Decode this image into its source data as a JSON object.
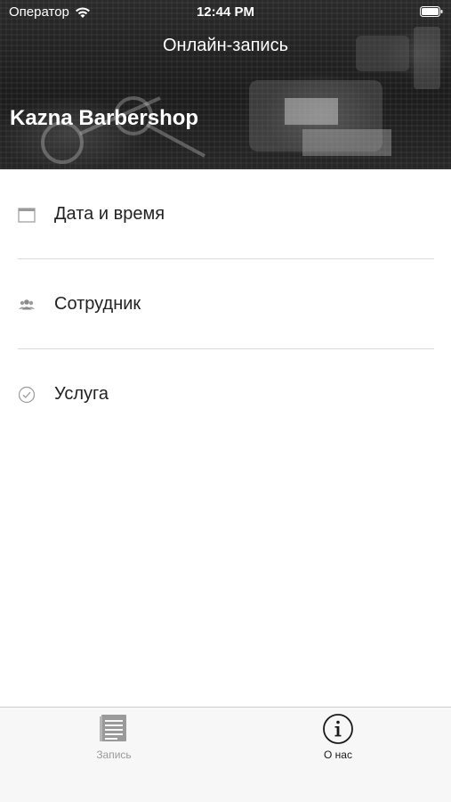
{
  "status_bar": {
    "carrier": "Оператор",
    "time": "12:44 PM",
    "wifi_icon": "wifi-icon",
    "battery_icon": "battery-icon"
  },
  "header": {
    "nav_title": "Онлайн-запись",
    "brand": "Kazna Barbershop"
  },
  "menu": {
    "items": [
      {
        "label": "Дата и время",
        "icon": "calendar-icon"
      },
      {
        "label": "Сотрудник",
        "icon": "people-icon"
      },
      {
        "label": "Услуга",
        "icon": "checkmark-circle-icon"
      }
    ]
  },
  "tab_bar": {
    "tabs": [
      {
        "label": "Запись",
        "icon": "list-document-icon",
        "selected": false
      },
      {
        "label": "О нас",
        "icon": "info-icon",
        "selected": true
      }
    ]
  },
  "colors": {
    "header_bg": "#1f1f1f",
    "text_primary": "#222222",
    "separator": "#d9d9d9",
    "tab_bar_bg": "#f7f7f7",
    "tab_inactive": "#9a9a9a",
    "tab_active": "#1a1a1a"
  }
}
